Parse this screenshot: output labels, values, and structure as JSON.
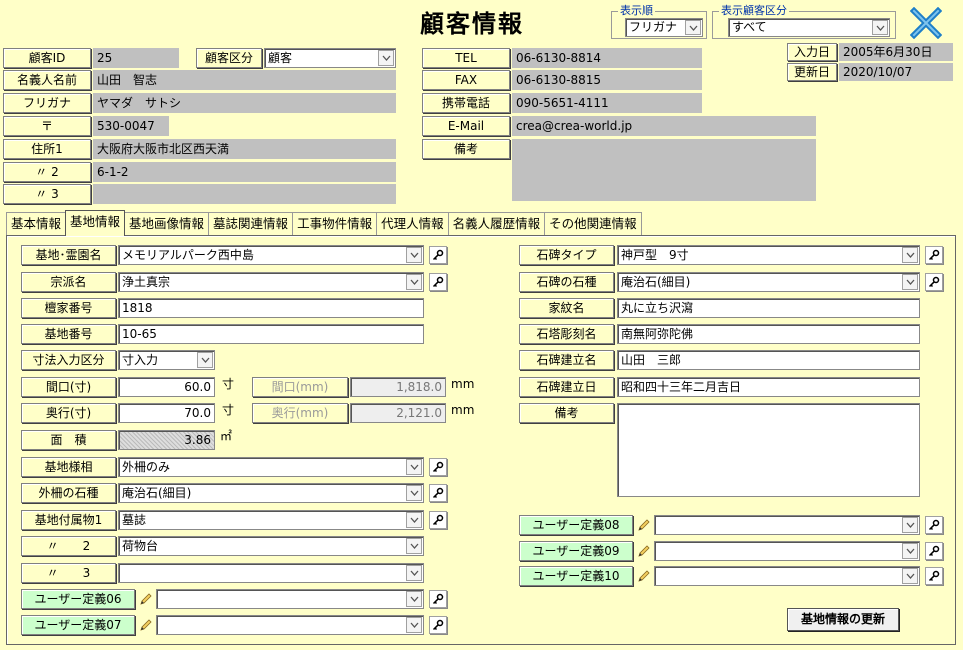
{
  "title": "顧客情報",
  "sort_group": {
    "title": "表示順",
    "value": "フリガナ"
  },
  "filter_group": {
    "title": "表示顧客区分",
    "value": "すべて"
  },
  "header": {
    "customer_id": {
      "label": "顧客ID",
      "value": "25"
    },
    "customer_type": {
      "label": "顧客区分",
      "value": "顧客"
    },
    "holder_name": {
      "label": "名義人名前",
      "value": "山田　智志"
    },
    "furigana": {
      "label": "フリガナ",
      "value": "ヤマダ　サトシ"
    },
    "postal": {
      "label": "〒",
      "value": "530-0047"
    },
    "address1": {
      "label": "住所1",
      "value": "大阪府大阪市北区西天満"
    },
    "address2": {
      "label": "〃 2",
      "value": "6-1-2"
    },
    "address3": {
      "label": "〃 3",
      "value": ""
    },
    "tel": {
      "label": "TEL",
      "value": "06-6130-8814"
    },
    "fax": {
      "label": "FAX",
      "value": "06-6130-8815"
    },
    "mobile": {
      "label": "携帯電話",
      "value": "090-5651-4111"
    },
    "email": {
      "label": "E-Mail",
      "value": "crea@crea-world.jp"
    },
    "remarks": {
      "label": "備考",
      "value": ""
    },
    "input_date": {
      "label": "入力日",
      "value": "2005年6月30日"
    },
    "update_date": {
      "label": "更新日",
      "value": "2020/10/07"
    }
  },
  "tabs": [
    "基本情報",
    "基地情報",
    "基地画像情報",
    "墓誌関連情報",
    "工事物件情報",
    "代理人情報",
    "名義人履歴情報",
    "その他関連情報"
  ],
  "left": {
    "cemetery": {
      "label": "基地･霊園名",
      "value": "メモリアルパーク西中島"
    },
    "sect": {
      "label": "宗派名",
      "value": "浄土真宗"
    },
    "danka_no": {
      "label": "檀家番号",
      "value": "1818"
    },
    "plot_no": {
      "label": "基地番号",
      "value": "10-65"
    },
    "size_mode": {
      "label": "寸法入力区分",
      "value": "寸入力"
    },
    "width_sun": {
      "label": "間口(寸)",
      "value": "60.0",
      "unit": "寸"
    },
    "depth_sun": {
      "label": "奥行(寸)",
      "value": "70.0",
      "unit": "寸"
    },
    "width_mm": {
      "label": "間口(mm)",
      "value": "1,818.0",
      "unit": "mm"
    },
    "depth_mm": {
      "label": "奥行(mm)",
      "value": "2,121.0",
      "unit": "mm"
    },
    "area": {
      "label": "面　積",
      "value": "3.86",
      "unit": "㎡"
    },
    "plot_style": {
      "label": "基地様相",
      "value": "外柵のみ"
    },
    "fence_stone": {
      "label": "外柵の石種",
      "value": "庵治石(細目)"
    },
    "accessory1": {
      "label": "基地付属物1",
      "value": "墓誌"
    },
    "accessory2": {
      "label": "〃　　2",
      "value": "荷物台"
    },
    "accessory3": {
      "label": "〃　　3",
      "value": ""
    },
    "user06": {
      "label": "ユーザー定義06",
      "value": ""
    },
    "user07": {
      "label": "ユーザー定義07",
      "value": ""
    }
  },
  "right": {
    "stone_type": {
      "label": "石碑タイプ",
      "value": "神戸型　9寸"
    },
    "stone_kind": {
      "label": "石碑の石種",
      "value": "庵治石(細目)"
    },
    "crest": {
      "label": "家紋名",
      "value": "丸に立ち沢瀉"
    },
    "inscription": {
      "label": "石塔彫刻名",
      "value": "南無阿弥陀佛"
    },
    "builder": {
      "label": "石碑建立名",
      "value": "山田　三郎"
    },
    "build_date": {
      "label": "石碑建立日",
      "value": "昭和四十三年二月吉日"
    },
    "remarks": {
      "label": "備考",
      "value": ""
    },
    "user08": {
      "label": "ユーザー定義08",
      "value": ""
    },
    "user09": {
      "label": "ユーザー定義09",
      "value": ""
    },
    "user10": {
      "label": "ユーザー定義10",
      "value": ""
    }
  },
  "update_button": "基地情報の更新"
}
